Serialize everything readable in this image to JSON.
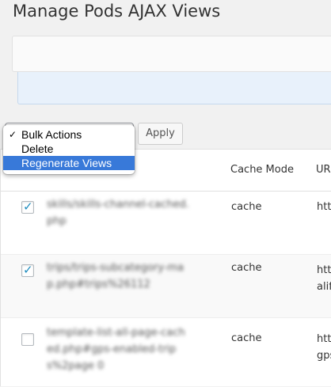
{
  "page_title": "Manage Pods AJAX Views",
  "bulk": {
    "options": [
      {
        "label": "Bulk Actions",
        "checked": true,
        "highlighted": false
      },
      {
        "label": "Delete",
        "checked": false,
        "highlighted": false
      },
      {
        "label": "Regenerate Views",
        "checked": false,
        "highlighted": true
      }
    ],
    "apply_label": "Apply"
  },
  "table": {
    "headers": {
      "cache_mode": "Cache Mode",
      "url": "UR"
    },
    "rows": [
      {
        "checked": true,
        "name": "skills/skills-channel-cached.php",
        "mode": "cache",
        "url_1": "http",
        "url_2": ""
      },
      {
        "checked": true,
        "name": "trips/trips-subcategory-map.php#trips%26112",
        "mode": "cache",
        "url_1": "http",
        "url_2": "alifo"
      },
      {
        "checked": false,
        "name": "template-list-all-page-cached.php#gps-enabled-trips%2page 0",
        "mode": "cache",
        "url_1": "http",
        "url_2": "gps"
      }
    ]
  },
  "colors": {
    "highlight": "#3879d9",
    "notice_bg": "#e8f1fb",
    "checkbox_tick": "#1e8cbe"
  }
}
